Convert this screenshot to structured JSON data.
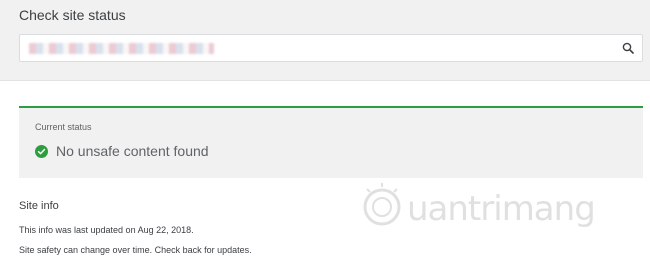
{
  "header": {
    "title": "Check site status",
    "search": {
      "value_redacted": true,
      "icon": "search-icon"
    }
  },
  "status_card": {
    "label": "Current status",
    "icon": "check-circle-icon",
    "message": "No unsafe content found",
    "accent_color": "#2e9d3f"
  },
  "site_info": {
    "title": "Site info",
    "lines": [
      "This info was last updated on Aug 22, 2018.",
      "Site safety can change over time. Check back for updates."
    ]
  },
  "watermark": {
    "text": "uantrimang"
  }
}
